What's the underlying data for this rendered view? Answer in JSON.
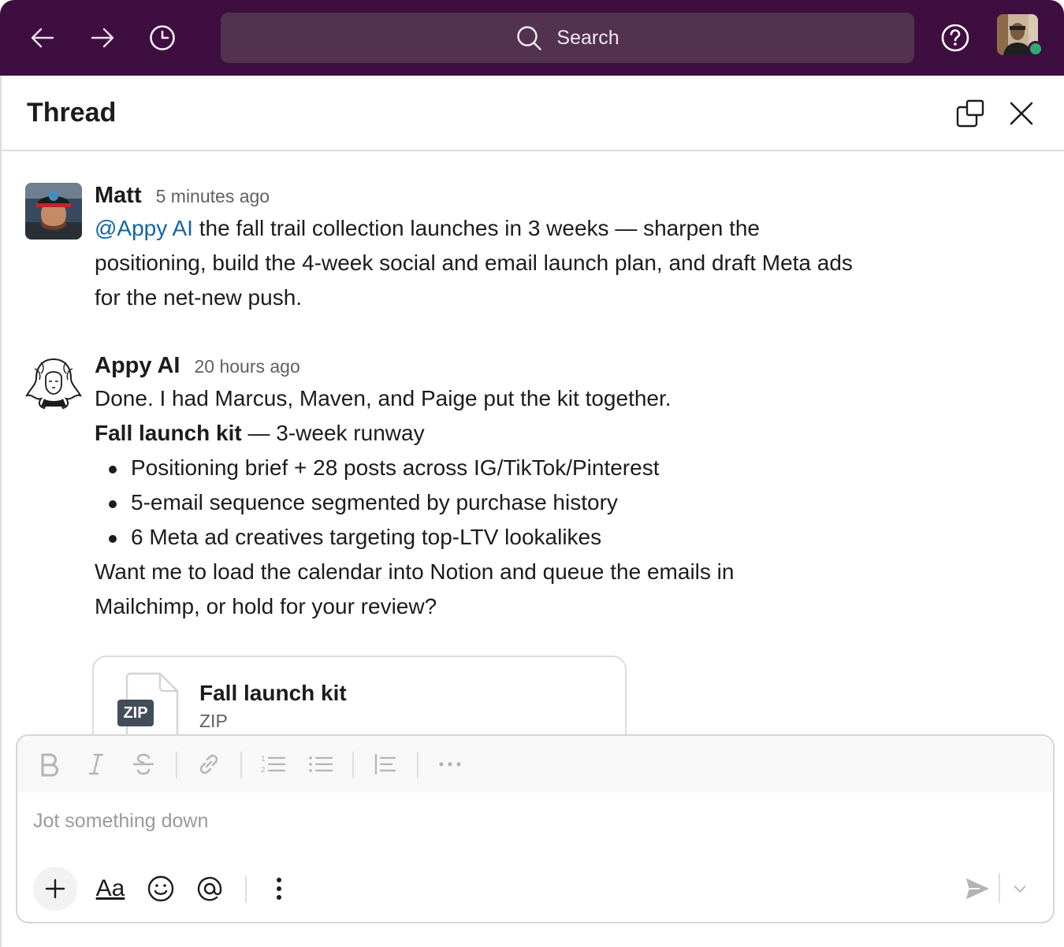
{
  "topbar": {
    "search_placeholder": "Search",
    "icons": [
      "back-arrow-icon",
      "forward-arrow-icon",
      "history-clock-icon",
      "search-icon",
      "help-icon"
    ],
    "bg_color": "#3f0e40",
    "presence_color": "#2bac76"
  },
  "thread": {
    "title": "Thread"
  },
  "messages": [
    {
      "author": "Matt",
      "time": "5 minutes ago",
      "mention": "@Appy AI",
      "text": " the fall trail collection launches in 3 weeks — sharpen the positioning, build the 4-week social and email launch plan, and draft Meta ads for the net-new push."
    },
    {
      "author": "Appy AI",
      "time": "20 hours ago",
      "intro": "Done. I had Marcus, Maven, and Paige put the kit together.",
      "kit_title": "Fall launch kit",
      "kit_subtitle": " — 3-week runway",
      "bullets": [
        "Positioning brief + 28 posts across IG/TikTok/Pinterest",
        "5-email sequence segmented by purchase history",
        "6 Meta ad creatives targeting top-LTV lookalikes"
      ],
      "outro": "Want me to load the calendar into Notion and queue the emails in Mailchimp, or hold for your review?",
      "attachment": {
        "name": "Fall launch kit",
        "type": "ZIP",
        "badge": "ZIP"
      }
    }
  ],
  "composer": {
    "placeholder": "Jot something down",
    "format_label": "Aa"
  }
}
